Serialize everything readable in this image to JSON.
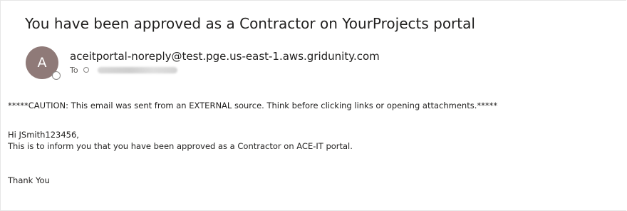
{
  "email": {
    "subject": "You have been approved as a Contractor on YourProjects portal",
    "sender": {
      "avatar_initial": "A",
      "avatar_color": "#8f7a78",
      "address": "aceitportal-noreply@test.pge.us-east-1.aws.gridunity.com"
    },
    "to_label": "To",
    "body": {
      "caution": "*****CAUTION: This email was sent from an EXTERNAL source. Think before clicking links or opening attachments.*****",
      "greeting": "Hi JSmith123456,",
      "message": "This is to inform you that you have been approved as a Contractor on ACE-IT portal.",
      "signoff": "Thank You"
    }
  }
}
